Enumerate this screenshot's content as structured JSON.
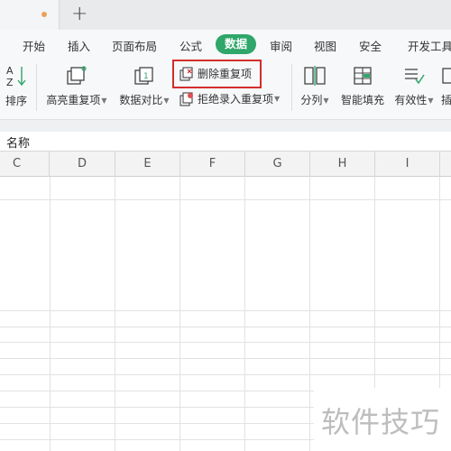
{
  "tabstrip": {
    "new_tab_symbol": "+"
  },
  "menu": {
    "items": [
      "开始",
      "插入",
      "页面布局",
      "公式",
      "数据",
      "审阅",
      "视图",
      "安全",
      "开发工具"
    ],
    "active": "数据",
    "active_color": "#2fa66a"
  },
  "toolbar": {
    "sort_label": "排序",
    "highlight_dup_label": "高亮重复项",
    "compare_label": "数据对比",
    "remove_dup_label": "删除重复项",
    "reject_dup_label": "拒绝录入重复项",
    "split_label": "分列",
    "fill_label": "智能填充",
    "validity_label": "有效性",
    "cut_label": "插",
    "highlight_box_color": "#d42d2d"
  },
  "namebox": {
    "label": "名称"
  },
  "columns": [
    "C",
    "D",
    "E",
    "F",
    "G",
    "H",
    "I"
  ],
  "watermark": "软件技巧"
}
